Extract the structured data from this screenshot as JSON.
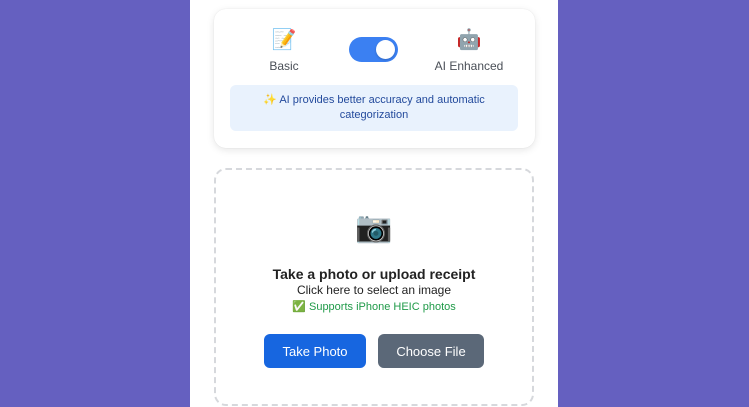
{
  "mode": {
    "basic": {
      "icon": "📝",
      "label": "Basic"
    },
    "ai": {
      "icon": "🤖",
      "label": "AI Enhanced"
    },
    "toggle_on": true,
    "info_text": "✨ AI provides better accuracy and automatic categorization"
  },
  "upload": {
    "icon": "📷",
    "title": "Take a photo or upload receipt",
    "subtitle": "Click here to select an image",
    "note": "✅ Supports iPhone HEIC photos",
    "take_photo_label": "Take Photo",
    "choose_file_label": "Choose File"
  },
  "colors": {
    "background": "#6560c0",
    "toggle_accent": "#3b80f2",
    "primary_button": "#1766e0",
    "secondary_button": "#5b6878",
    "success_text": "#1f9a48"
  }
}
